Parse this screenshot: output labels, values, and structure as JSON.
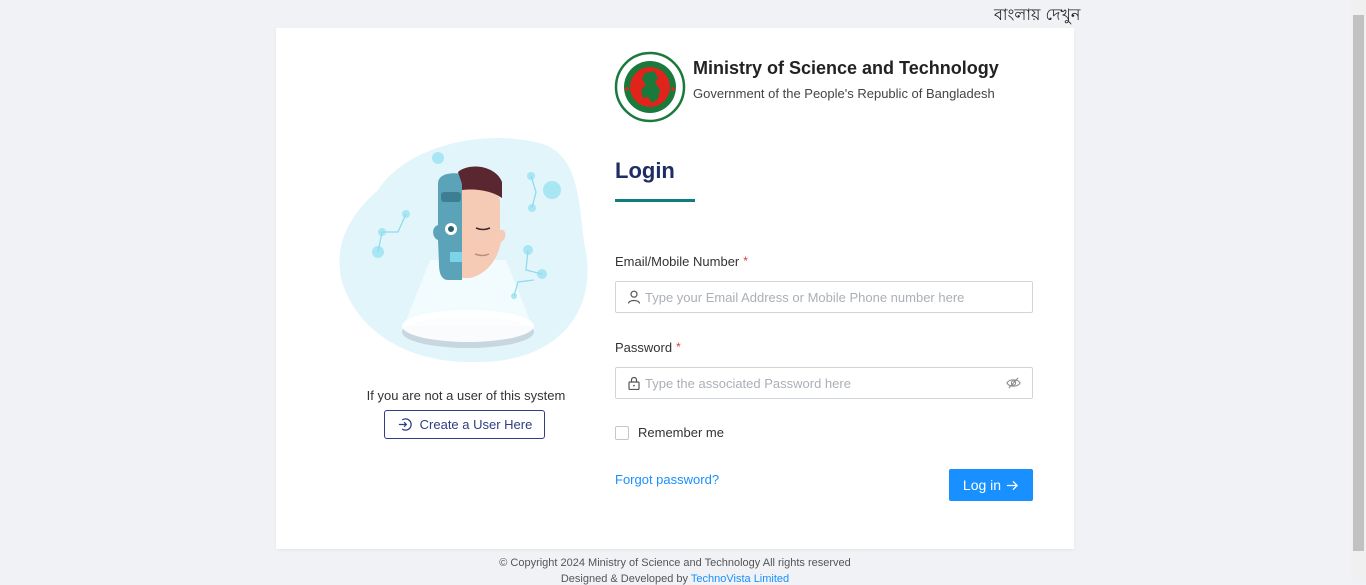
{
  "lang_switch": "বাংলায় দেখুন",
  "header": {
    "ministry": "Ministry of Science and Technology",
    "government": "Government of the People's Republic of Bangladesh"
  },
  "left": {
    "not_user_text": "If you are not a user of this system",
    "create_user_label": "Create a User Here"
  },
  "login": {
    "title": "Login",
    "email_label": "Email/Mobile Number",
    "email_placeholder": "Type your Email Address or Mobile Phone number here",
    "email_value": "",
    "password_label": "Password",
    "password_placeholder": "Type the associated Password here",
    "password_value": "",
    "required_mark": "*",
    "remember_label": "Remember me",
    "forgot_label": "Forgot password?",
    "submit_label": "Log in"
  },
  "footer": {
    "copyright": "© Copyright 2024 Ministry of Science and Technology All rights reserved",
    "designed_prefix": "Designed & Developed by",
    "designed_link": "TechnoVista Limited"
  },
  "colors": {
    "brand_navy": "#1f2d64",
    "accent_teal": "#0f7c80",
    "primary_blue": "#1890ff",
    "emblem_green": "#1a7a3c",
    "emblem_red": "#e0241b"
  },
  "icons": {
    "emblem": "bangladesh-government-emblem",
    "user": "user-icon",
    "lock": "lock-icon",
    "eye": "eye-invisible-icon",
    "login_arrow": "arrow-right-icon",
    "create": "login-circle-icon"
  }
}
